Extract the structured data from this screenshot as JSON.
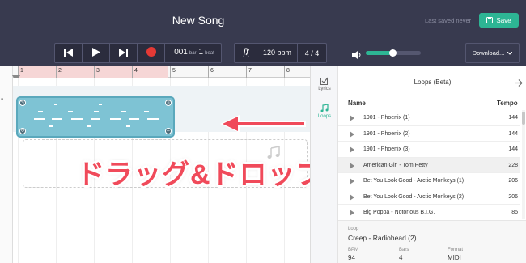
{
  "header": {
    "song_title": "New Song",
    "last_saved": "Last saved never",
    "save_label": "Save",
    "download_label": "Download..."
  },
  "transport": {
    "bar": "001",
    "bar_unit": "bar",
    "beat": "1",
    "beat_unit": "beat"
  },
  "tempo": {
    "bpm": "120 bpm",
    "signature": "4 / 4"
  },
  "volume": {
    "level": 0.48
  },
  "ruler": {
    "marks": [
      "1",
      "2",
      "3",
      "4",
      "5",
      "6",
      "7",
      "8"
    ]
  },
  "overlay": {
    "jp_text": "ドラッグ&ドロップ"
  },
  "side_tabs": {
    "lyrics": "Lyrics",
    "loops": "Loops"
  },
  "loops_panel": {
    "title": "Loops (Beta)",
    "col_name": "Name",
    "col_tempo": "Tempo",
    "rows": [
      {
        "name": "1901 - Phoenix (1)",
        "tempo": "144"
      },
      {
        "name": "1901 - Phoenix (2)",
        "tempo": "144"
      },
      {
        "name": "1901 - Phoenix (3)",
        "tempo": "144"
      },
      {
        "name": "American Girl - Tom Petty",
        "tempo": "228"
      },
      {
        "name": "Bet You Look Good - Arctic Monkeys (1)",
        "tempo": "206"
      },
      {
        "name": "Bet You Look Good - Arctic Monkeys (2)",
        "tempo": "206"
      },
      {
        "name": "Big Poppa - Notorious B.I.G.",
        "tempo": "85"
      }
    ]
  },
  "loop_info": {
    "loop_label": "Loop",
    "loop_name": "Creep - Radiohead (2)",
    "bpm_label": "BPM",
    "bpm_value": "94",
    "bars_label": "Bars",
    "bars_value": "4",
    "format_label": "Format",
    "format_value": "MIDI"
  },
  "colors": {
    "header_bg": "#383a4f",
    "accent": "#2db594",
    "clip": "#7ec3d4",
    "overlay_text": "#f04a5a"
  }
}
